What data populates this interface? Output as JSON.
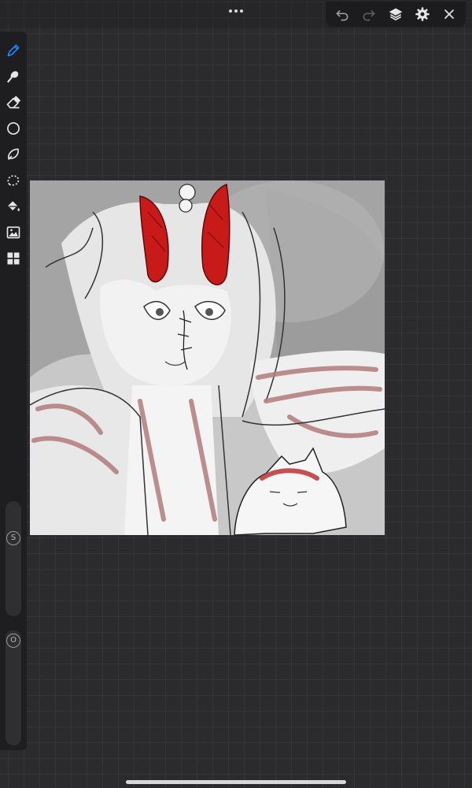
{
  "top_bar": {
    "more_icon": "ellipsis-icon",
    "toolbar": [
      "undo-icon",
      "redo-icon",
      "layers-icon",
      "gear-icon",
      "close-icon"
    ]
  },
  "side_toolbar": {
    "tools": [
      "brush-icon",
      "smudge-icon",
      "eraser-icon",
      "shape-icon",
      "lasso-freehand-icon",
      "selection-icon",
      "fill-bucket-icon",
      "image-import-icon",
      "adjustments-icon"
    ],
    "size_slider": {
      "label": "S"
    },
    "opacity_slider": {
      "label": "O"
    }
  },
  "colors": {
    "accent": "#1e88ff",
    "ui_dark": "#1e1e20",
    "canvas_bg": "#2b2b2d",
    "horn_red": "#c91a1a",
    "shade_red": "#b07a7a"
  }
}
